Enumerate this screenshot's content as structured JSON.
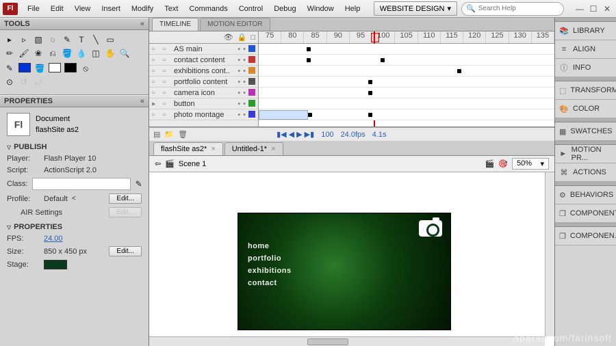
{
  "menubar": {
    "items": [
      "File",
      "Edit",
      "View",
      "Insert",
      "Modify",
      "Text",
      "Commands",
      "Control",
      "Debug",
      "Window",
      "Help"
    ],
    "workspace": "WEBSITE DESIGN",
    "search_placeholder": "Search Help"
  },
  "tools": {
    "title": "TOOLS"
  },
  "properties": {
    "title": "PROPERTIES",
    "doc_type": "Document",
    "doc_name": "flashSite as2",
    "publish_title": "PUBLISH",
    "player_label": "Player:",
    "player_value": "Flash Player 10",
    "script_label": "Script:",
    "script_value": "ActionScript 2.0",
    "class_label": "Class:",
    "profile_label": "Profile:",
    "profile_value": "Default",
    "air_label": "AIR Settings",
    "props_title": "PROPERTIES",
    "fps_label": "FPS:",
    "fps_value": "24.00",
    "size_label": "Size:",
    "size_value": "850 x 450 px",
    "stage_label": "Stage:",
    "edit_btn": "Edit..."
  },
  "timeline": {
    "tabs": [
      "TIMELINE",
      "MOTION EDITOR"
    ],
    "ruler": [
      "75",
      "80",
      "85",
      "90",
      "95",
      "100",
      "105",
      "110",
      "115",
      "120",
      "125",
      "130",
      "135"
    ],
    "layers": [
      {
        "name": "AS main",
        "color": "#2255dd"
      },
      {
        "name": "contact content",
        "color": "#cc3333"
      },
      {
        "name": "exhibitions cont..",
        "color": "#d88a2a"
      },
      {
        "name": "portfolio content",
        "color": "#555555"
      },
      {
        "name": "camera icon",
        "color": "#c02fb2"
      },
      {
        "name": "button",
        "color": "#2a9a2a",
        "folder": true
      },
      {
        "name": "photo montage",
        "color": "#3a3adf"
      }
    ],
    "footer": {
      "frame": "100",
      "fps": "24.0fps",
      "time": "4.1s"
    }
  },
  "doc_tabs": [
    {
      "label": "flashSite as2*"
    },
    {
      "label": "Untitled-1*"
    }
  ],
  "scene": {
    "label": "Scene 1",
    "zoom": "50%"
  },
  "canvas_nav": [
    "home",
    "portfolio",
    "exhibitions",
    "contact"
  ],
  "right_panels": [
    "LIBRARY",
    "ALIGN",
    "INFO",
    "TRANSFORM",
    "COLOR",
    "SWATCHES",
    "MOTION PR...",
    "ACTIONS",
    "BEHAVIORS",
    "COMPONENTS",
    "COMPONEN..."
  ],
  "right_icons": [
    "📚",
    "≡",
    "ⓘ",
    "⬚",
    "🎨",
    "▦",
    "►",
    "⌘",
    "⚙",
    "❐",
    "❐"
  ],
  "watermark": "aparat.com/farinsoft"
}
